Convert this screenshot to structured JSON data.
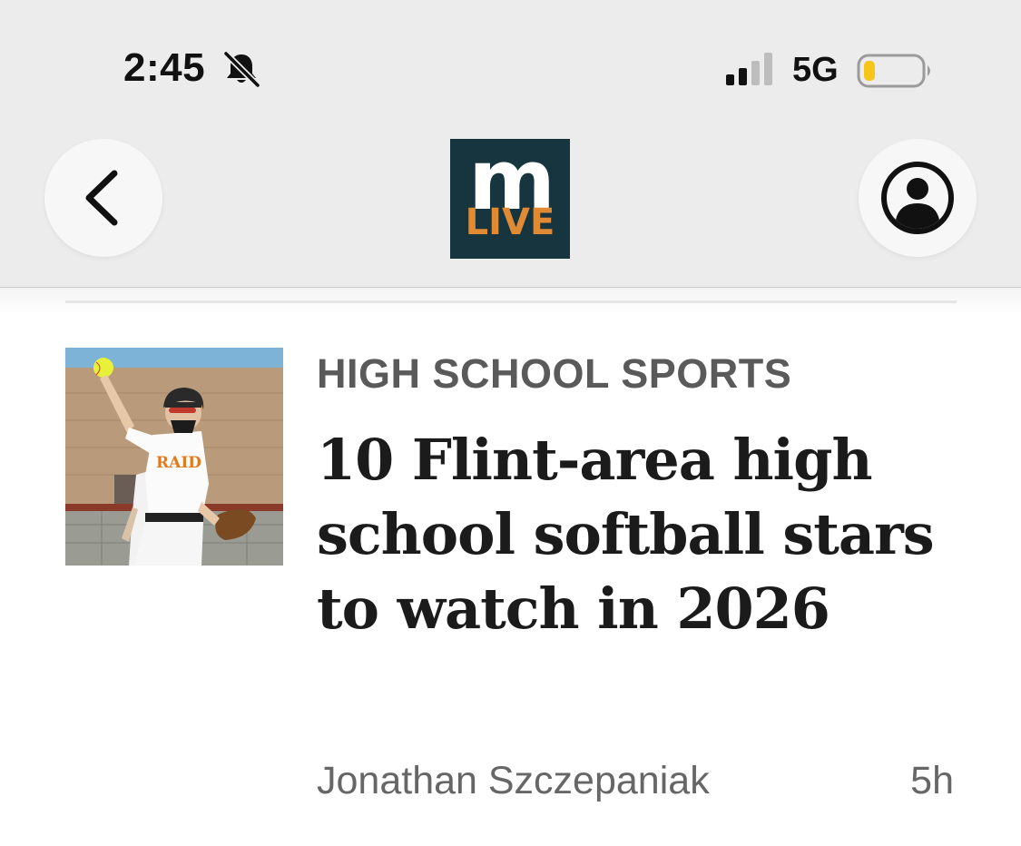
{
  "status_bar": {
    "time": "2:45",
    "network": "5G",
    "icons": [
      "bell-muted-icon",
      "signal-bars-icon",
      "battery-icon"
    ],
    "signal_bars_active": 2,
    "signal_bars_total": 4,
    "battery_level": 0.15,
    "battery_color": "#f5c518"
  },
  "nav": {
    "back_icon": "chevron-left-icon",
    "account_icon": "user-circle-icon",
    "logo": {
      "top": "m",
      "bottom": "LIVE",
      "bg_color": "#17353f",
      "accent_color": "#e08a34"
    }
  },
  "article": {
    "category": "HIGH SCHOOL SPORTS",
    "headline": "10 Flint-area high school softball stars to watch in 2026",
    "author": "Jonathan Szczepaniak",
    "age": "5h",
    "thumbnail_subject": "softball-player-throwing-image",
    "jersey_text": "RAIDE"
  }
}
